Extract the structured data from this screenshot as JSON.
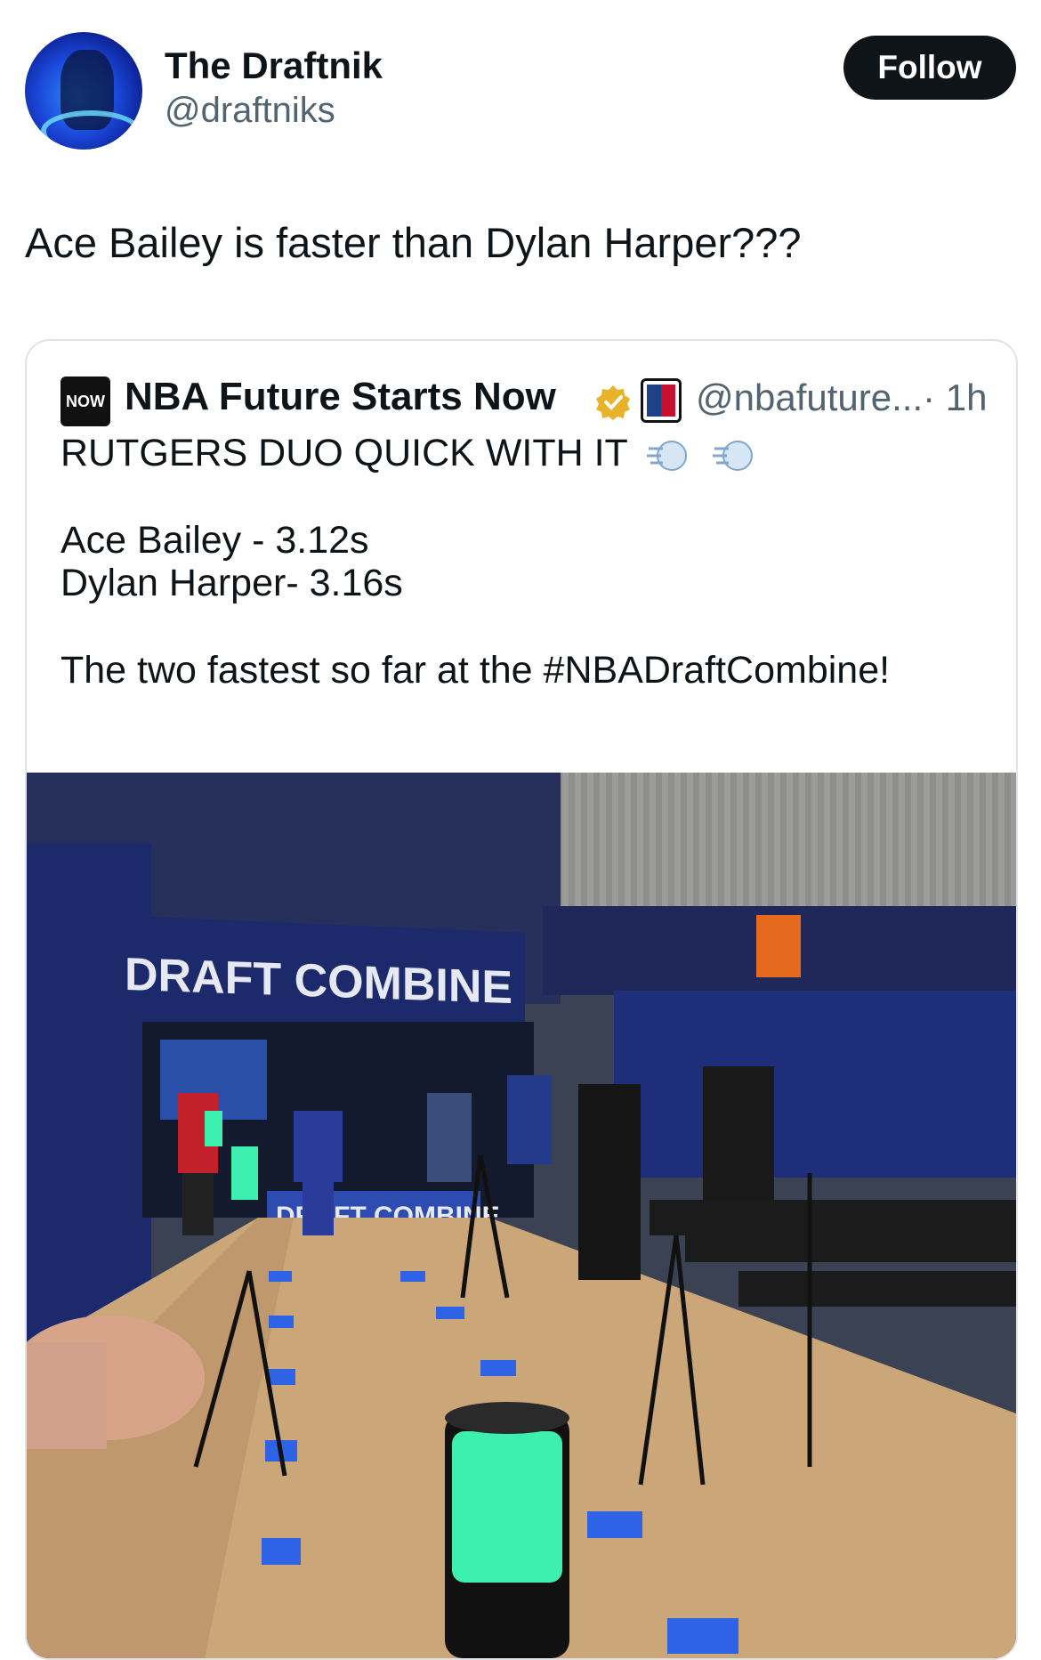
{
  "author": {
    "name": "The Draftnik",
    "handle": "@draftniks",
    "avatar_icon": "player-silhouette-avatar"
  },
  "follow_label": "Follow",
  "tweet_text": "Ace Bailey is faster than Dylan Harper???",
  "quoted": {
    "logo_text": "NOW",
    "name": "NBA Future Starts Now",
    "handle": "@nbafuture...",
    "time": "· 1h",
    "lines": [
      "RUTGERS DUO QUICK WITH IT",
      "Ace Bailey - 3.12s",
      "Dylan Harper- 3.16s",
      "The two fastest so far at the #NBADraftCombine!"
    ],
    "media": {
      "banner_left": "DRAFT COMBINE",
      "banner_floor": "DRAFT COMBINE"
    }
  },
  "colors": {
    "accent_text": "#0f1419",
    "secondary_text": "#536471",
    "verified_gold": "#e8b32a",
    "arena_blue": "#1c2a6b",
    "floor_wood": "#caa679",
    "tape_blue": "#2e63e6",
    "sensor_green": "#3df0b0"
  }
}
